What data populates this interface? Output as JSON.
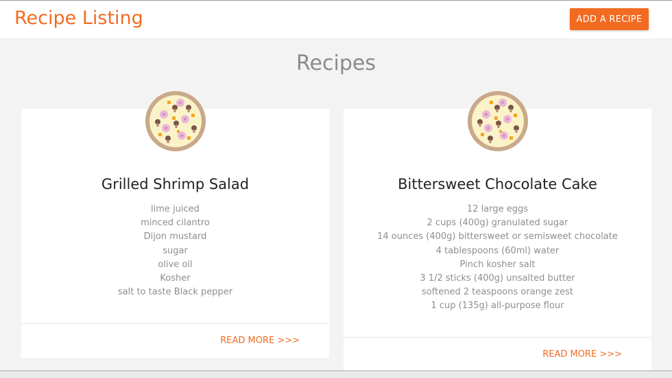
{
  "header": {
    "brand": "Recipe Listing",
    "add_button": "ADD A RECIPE"
  },
  "page": {
    "title": "Recipes"
  },
  "recipes": [
    {
      "name": "Grilled Shrimp Salad",
      "ingredients": [
        "lime juiced",
        "minced cilantro",
        "Dijon mustard",
        "sugar",
        "olive oil",
        "Kosher",
        "salt to taste Black pepper"
      ],
      "read_more": "READ MORE >>>",
      "icon": "pizza-icon"
    },
    {
      "name": "Bittersweet Chocolate Cake",
      "ingredients": [
        "12 large eggs",
        "2 cups (400g) granulated sugar",
        "14 ounces (400g) bittersweet or semisweet chocolate",
        "4 tablespoons (60ml) water",
        "Pinch kosher salt",
        "3 1/2 sticks (400g) unsalted butter",
        "softened 2 teaspoons orange zest",
        "1 cup (135g) all-purpose flour"
      ],
      "read_more": "READ MORE >>>",
      "icon": "pizza-icon"
    }
  ],
  "colors": {
    "accent": "#f26b21",
    "background": "#f3f3f3",
    "card": "#ffffff",
    "muted_text": "#8e8e8e"
  }
}
